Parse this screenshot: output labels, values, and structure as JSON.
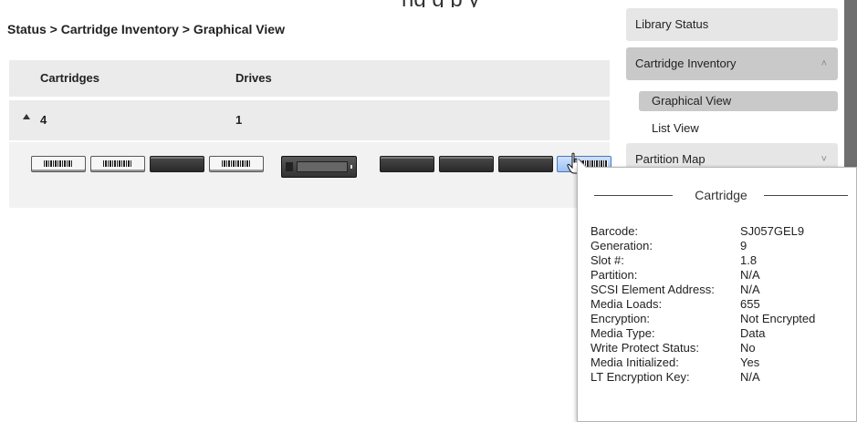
{
  "top_clipped_text": "ng                        g        p y",
  "breadcrumb": "Status > Cartridge Inventory > Graphical View",
  "summary": {
    "headers": [
      "Cartridges",
      "Drives"
    ],
    "values": [
      "4",
      "1"
    ]
  },
  "sidebar": {
    "items": [
      {
        "label": "Library Status"
      },
      {
        "label": "Cartridge Inventory"
      },
      {
        "label": "Partition Map"
      }
    ],
    "sub_items": [
      {
        "label": "Graphical View"
      },
      {
        "label": "List View"
      }
    ]
  },
  "popup": {
    "title": "Cartridge",
    "rows": [
      {
        "key": "Barcode:",
        "value": "SJ057GEL9"
      },
      {
        "key": "Generation:",
        "value": "9"
      },
      {
        "key": "Slot #:",
        "value": "1.8"
      },
      {
        "key": "Partition:",
        "value": "N/A"
      },
      {
        "key": "SCSI Element Address:",
        "value": "N/A"
      },
      {
        "key": "Media Loads:",
        "value": "655"
      },
      {
        "key": "Encryption:",
        "value": "Not Encrypted"
      },
      {
        "key": "Media Type:",
        "value": "Data"
      },
      {
        "key": "Write Protect Status:",
        "value": "No"
      },
      {
        "key": "Media Initialized:",
        "value": "Yes"
      },
      {
        "key": "LT Encryption Key:",
        "value": "N/A"
      }
    ]
  },
  "colors": {
    "panel_bg": "#ebebeb",
    "sidebar_active": "#c9c9c9",
    "selected_cartridge": "#9bc0f5"
  },
  "icons": [
    "caret-up-icon",
    "chevron-up-double-icon",
    "chevron-down-double-icon",
    "hand-cursor-icon"
  ]
}
